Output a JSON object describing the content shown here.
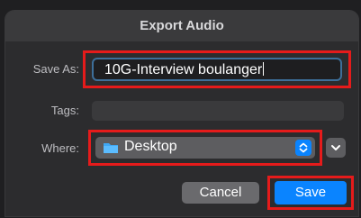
{
  "dialog": {
    "title": "Export Audio"
  },
  "save_as": {
    "label": "Save As:",
    "value": "10G-Interview boulanger"
  },
  "tags": {
    "label": "Tags:",
    "value": ""
  },
  "where": {
    "label": "Where:",
    "value": "Desktop",
    "icon": "folder-icon"
  },
  "buttons": {
    "cancel": "Cancel",
    "save": "Save"
  },
  "colors": {
    "accent": "#0a84ff",
    "highlight": "#e51b1b",
    "background": "#2c2c2e"
  }
}
